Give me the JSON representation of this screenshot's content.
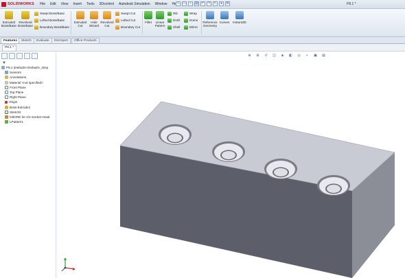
{
  "app": {
    "logo_text": "SOLIDWORKS",
    "document_title": "P8.1 *"
  },
  "menu": [
    "File",
    "Edit",
    "View",
    "Insert",
    "Tools",
    "3Dcontrol",
    "Autodesk Simulation",
    "Window",
    "Help"
  ],
  "quick_access": [
    "new",
    "open",
    "save",
    "print",
    "undo",
    "redo",
    "select",
    "rebuild",
    "options"
  ],
  "commands": {
    "extruded_boss": "Extruded Boss/Base",
    "revolved_boss": "Revolved Boss/Base",
    "swept_boss": "Swept Boss/Base",
    "lofted_boss": "Lofted Boss/Base",
    "boundary_boss": "Boundary Boss/Base",
    "extruded_cut": "Extruded Cut",
    "hole_wizard": "Hole Wizard",
    "revolved_cut": "Revolved Cut",
    "swept_cut": "Swept Cut",
    "lofted_cut": "Lofted Cut",
    "boundary_cut": "Boundary Cut",
    "fillet": "Fillet",
    "linear_pattern": "Linear Pattern",
    "rib": "Rib",
    "draft": "Draft",
    "shell": "Shell",
    "wrap": "Wrap",
    "dome": "Dome",
    "mirror": "Mirror",
    "reference_geometry": "Reference Geometry",
    "curves": "Curves",
    "instant3d": "Instant3D"
  },
  "tabs": [
    "Features",
    "Sketch",
    "Evaluate",
    "DimXpert",
    "Office Products"
  ],
  "active_tab": "Features",
  "doc_tab": "P8.1 *",
  "tree": {
    "root": "P8.1  (Default<<Default>_Disp",
    "items": [
      "Sensors",
      "Annotations",
      "Material <not specified>",
      "Front Plane",
      "Top Plane",
      "Right Plane",
      "Origin",
      "Boss-Extrude1",
      "Sketch2",
      "CBORE for 1/2 Socket Head",
      "LPattern1"
    ]
  },
  "colors": {
    "part_top": "#c8cbd4",
    "part_front": "#5c5f6a",
    "part_side": "#8b8e97",
    "accent": "#c8102e",
    "ribbon_bg": "#e6ecf3"
  }
}
